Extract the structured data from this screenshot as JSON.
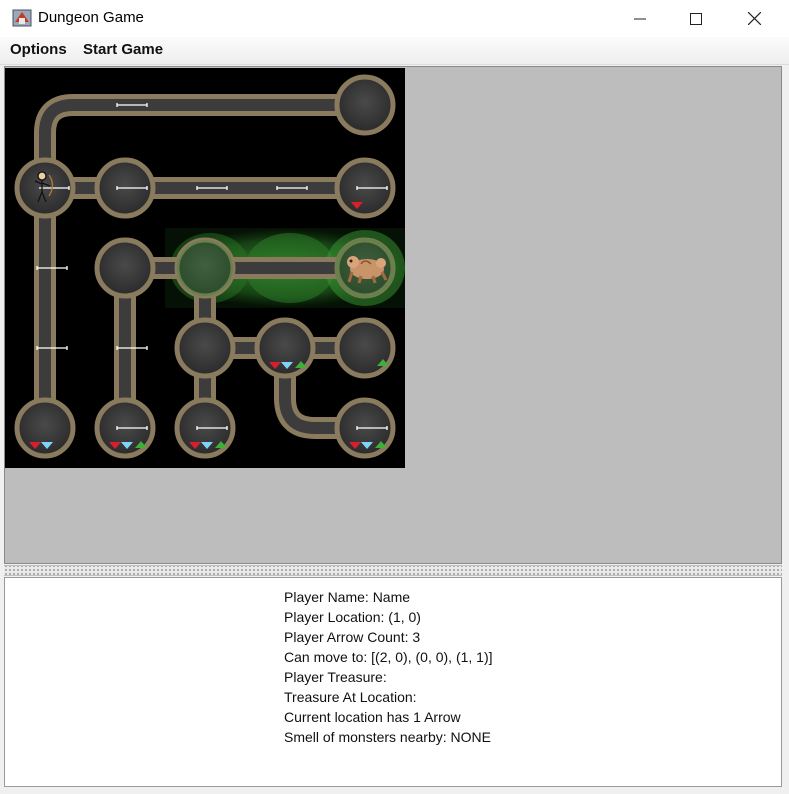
{
  "window": {
    "title": "Dungeon Game",
    "icons": [
      "app-icon",
      "minimize-icon",
      "maximize-icon",
      "close-icon"
    ]
  },
  "menu": {
    "items": [
      "Options",
      "Start Game"
    ]
  },
  "dungeon": {
    "rows": 5,
    "cols": 5,
    "player": {
      "row": 1,
      "col": 0
    },
    "monster": {
      "row": 2,
      "col": 4
    },
    "smell_zone": "row 2, columns 2–4",
    "arrows": [
      {
        "where": "top corridor"
      },
      {
        "where": "cave (1,0)"
      },
      {
        "where": "corridor (1,0)-(1,1)"
      },
      {
        "where": "corridor (1,1)-(1,2)"
      },
      {
        "where": "corridor (1,2)-(1,3)"
      },
      {
        "where": "cave (1,4)"
      },
      {
        "where": "corridor (1,0)-(2,0)"
      },
      {
        "where": "corridor (3,0)"
      },
      {
        "where": "corridor (3,1)"
      },
      {
        "where": "cave (4,1)"
      },
      {
        "where": "cave (4,2)"
      },
      {
        "where": "cave (4,4)"
      }
    ],
    "treasures": [
      {
        "cave": "(1,4)",
        "items": [
          "ruby"
        ]
      },
      {
        "cave": "(3,3)",
        "items": [
          "ruby",
          "diamond",
          "emerald"
        ]
      },
      {
        "cave": "(3,4)",
        "items": [
          "emerald"
        ]
      },
      {
        "cave": "(4,0)",
        "items": [
          "ruby",
          "diamond"
        ]
      },
      {
        "cave": "(4,1)",
        "items": [
          "ruby",
          "diamond",
          "emerald"
        ]
      },
      {
        "cave": "(4,2)",
        "items": [
          "ruby",
          "diamond",
          "emerald"
        ]
      },
      {
        "cave": "(4,4)",
        "items": [
          "ruby",
          "diamond",
          "emerald"
        ]
      }
    ],
    "colors": {
      "background": "#000000",
      "cave_fill": "#3a3a3a",
      "wall": "#8a7b5e",
      "smell": "#2f8a2a",
      "ruby": "#d8202a",
      "diamond": "#7fd4f5",
      "emerald": "#3fae3a"
    }
  },
  "info": {
    "lines": [
      "Player Name: Name",
      "Player Location: (1, 0)",
      "Player Arrow Count: 3",
      "Can move to: [(2, 0), (0, 0), (1, 1)]",
      "Player Treasure:",
      "Treasure At Location:",
      "Current location has 1 Arrow",
      "Smell of monsters nearby: NONE"
    ]
  }
}
